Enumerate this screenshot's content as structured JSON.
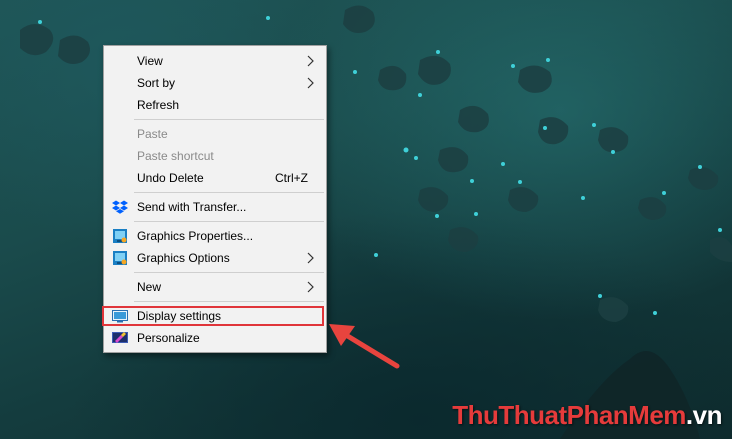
{
  "menu": {
    "items": [
      {
        "label": "View"
      },
      {
        "label": "Sort by"
      },
      {
        "label": "Refresh"
      },
      {
        "label": "Paste"
      },
      {
        "label": "Paste shortcut"
      },
      {
        "label": "Undo Delete",
        "shortcut": "Ctrl+Z"
      },
      {
        "label": "Send with Transfer...",
        "icon": "dropbox-icon"
      },
      {
        "label": "Graphics Properties...",
        "icon": "intel-graphics-icon"
      },
      {
        "label": "Graphics Options",
        "icon": "intel-graphics-icon"
      },
      {
        "label": "New"
      },
      {
        "label": "Display settings",
        "icon": "display-icon"
      },
      {
        "label": "Personalize",
        "icon": "personalize-icon"
      }
    ]
  },
  "watermark": {
    "part1": "ThuThuat",
    "part2": "PhanMem",
    "part3": ".vn"
  },
  "colors": {
    "highlight": "#e0353a",
    "menu_bg": "#f2f2f2",
    "accent": "#0f7fc2"
  }
}
